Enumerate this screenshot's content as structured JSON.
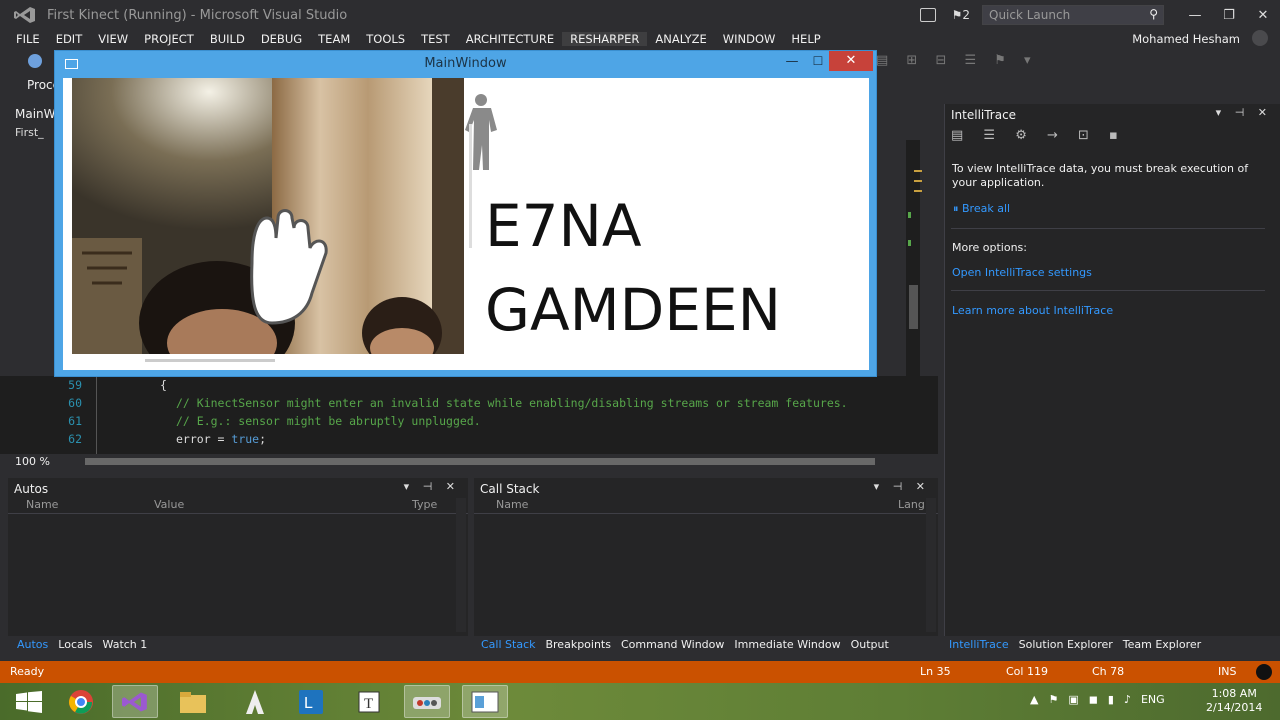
{
  "app": {
    "title": "First Kinect (Running) - Microsoft Visual Studio",
    "notification_count": "2",
    "quick_launch_placeholder": "Quick Launch",
    "user": "Mohamed Hesham"
  },
  "menu": [
    "FILE",
    "EDIT",
    "VIEW",
    "PROJECT",
    "BUILD",
    "DEBUG",
    "TEAM",
    "TOOLS",
    "TEST",
    "ARCHITECTURE",
    "RESHARPER",
    "ANALYZE",
    "WINDOW",
    "HELP"
  ],
  "editor": {
    "proc_label": "Proce",
    "doc_tab": "MainWi",
    "doc_sub": "First_",
    "lines": [
      {
        "num": "59",
        "text": "{"
      },
      {
        "num": "60",
        "text": "// KinectSensor might enter an invalid state while enabling/disabling streams or stream features."
      },
      {
        "num": "61",
        "text": "// E.g.: sensor might be abruptly unplugged."
      },
      {
        "num": "62",
        "text_a": "error = ",
        "text_kw": "true",
        "text_b": ";"
      }
    ],
    "zoom": "100 %"
  },
  "main_window": {
    "title": "MainWindow",
    "line1": "E7NA",
    "line2": "GAMDEEN"
  },
  "intellitrace": {
    "title": "IntelliTrace",
    "message": "To view IntelliTrace data, you must break execution of your application.",
    "break_all": "Break all",
    "more_options": "More options:",
    "open_settings": "Open IntelliTrace settings",
    "learn_more": "Learn more about IntelliTrace"
  },
  "autos": {
    "title": "Autos",
    "columns": [
      "Name",
      "Value",
      "Type"
    ],
    "tabs": [
      "Autos",
      "Locals",
      "Watch 1"
    ]
  },
  "callstack": {
    "title": "Call Stack",
    "columns": [
      "Name",
      "Lang"
    ],
    "tabs": [
      "Call Stack",
      "Breakpoints",
      "Command Window",
      "Immediate Window",
      "Output"
    ]
  },
  "right_tabs": [
    "IntelliTrace",
    "Solution Explorer",
    "Team Explorer"
  ],
  "status": {
    "ready": "Ready",
    "ln": "Ln 35",
    "col": "Col 119",
    "ch": "Ch 78",
    "mode": "INS"
  },
  "taskbar": {
    "lang": "ENG",
    "time": "1:08 AM",
    "date": "2/14/2014"
  },
  "colors": {
    "accent": "#007acc",
    "status_bar": "#ca5100",
    "link": "#3399ff",
    "close_button": "#c7423a"
  }
}
